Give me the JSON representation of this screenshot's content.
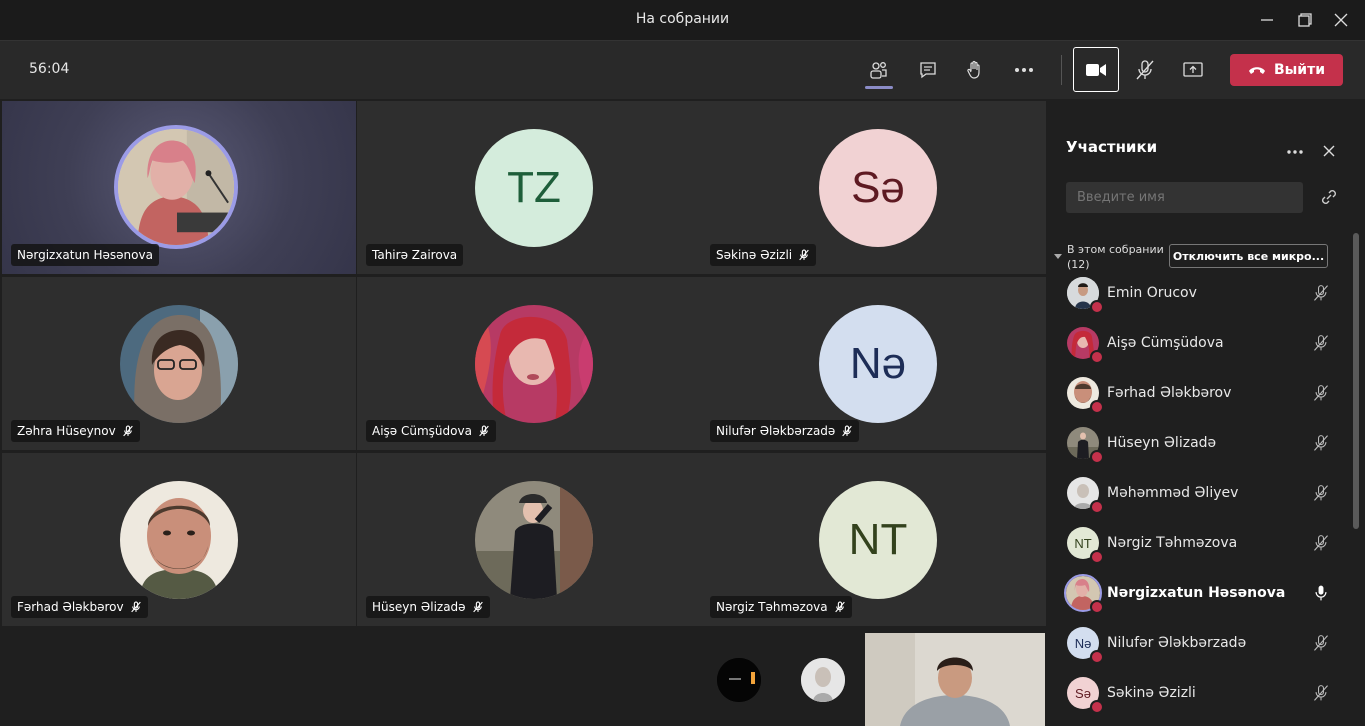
{
  "window": {
    "title": "На собрании"
  },
  "toolbar": {
    "timer": "56:04",
    "leave_label": "Выйти",
    "icons": [
      "participants-icon",
      "chat-icon",
      "raise-hand-icon",
      "more-icon",
      "camera-icon",
      "mic-off-icon",
      "share-icon",
      "hangup-icon"
    ]
  },
  "tiles": [
    {
      "name": "Nərgizxatun Həsənova",
      "initials": "",
      "muted": false,
      "speaking": true
    },
    {
      "name": "Tahirə Zairova",
      "initials": "TZ",
      "muted": false,
      "bg": "#d4ecdc",
      "fg": "#1e5e3a"
    },
    {
      "name": "Səkinə Əzizli",
      "initials": "Sə",
      "muted": true,
      "bg": "#f1d2d3",
      "fg": "#5e1a22"
    },
    {
      "name": "Zəhra Hüseynov",
      "initials": "",
      "muted": true
    },
    {
      "name": "Aişə Cümşüdova",
      "initials": "",
      "muted": true
    },
    {
      "name": "Nilufər Ələkbərzadə",
      "initials": "Nə",
      "muted": true,
      "bg": "#d3deef",
      "fg": "#1d2d57"
    },
    {
      "name": "Fərhad Ələkbərov",
      "initials": "",
      "muted": true
    },
    {
      "name": "Hüseyn Əlizadə",
      "initials": "",
      "muted": true
    },
    {
      "name": "Nərgiz Təhməzova",
      "initials": "NT",
      "muted": true,
      "bg": "#e2e8d5",
      "fg": "#33421d"
    }
  ],
  "panel": {
    "title": "Участники",
    "search_placeholder": "Введите имя",
    "section_label": "В этом собрании",
    "section_count": "(12)",
    "mute_all_label": "Отключить все микро...",
    "participants": [
      {
        "name": "Emin Orucov",
        "initials": "",
        "muted": true
      },
      {
        "name": "Aişə Cümşüdova",
        "initials": "",
        "muted": true
      },
      {
        "name": "Fərhad Ələkbərov",
        "initials": "",
        "muted": true
      },
      {
        "name": "Hüseyn Əlizadə",
        "initials": "",
        "muted": true
      },
      {
        "name": "Məhəmməd Əliyev",
        "initials": "",
        "muted": true
      },
      {
        "name": "Nərgiz Təhməzova",
        "initials": "NT",
        "muted": true,
        "bg": "#e2e8d5",
        "fg": "#33421d"
      },
      {
        "name": "Nərgizxatun Həsənova",
        "initials": "",
        "muted": false,
        "bold": true
      },
      {
        "name": "Nilufər Ələkbərzadə",
        "initials": "Nə",
        "muted": true,
        "bg": "#d3deef",
        "fg": "#1d2d57"
      },
      {
        "name": "Səkinə Əzizli",
        "initials": "Sə",
        "muted": true,
        "bg": "#f1d2d3",
        "fg": "#5e1a22"
      }
    ]
  },
  "colors": {
    "accent": "#8b8cc7",
    "leave": "#c4314b",
    "status_busy": "#c4314b"
  }
}
